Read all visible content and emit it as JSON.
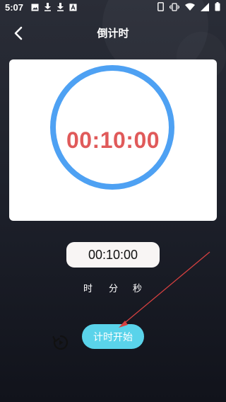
{
  "status_bar": {
    "time": "5:07",
    "left_icons": [
      "image-icon",
      "download-icon",
      "download-icon",
      "text-a-icon"
    ],
    "right_icons": [
      "phone-icon",
      "vibrate-icon",
      "wifi-icon",
      "signal-icon",
      "battery-icon"
    ]
  },
  "header": {
    "title": "倒计时",
    "back_icon": "chevron-left-icon"
  },
  "timer": {
    "display": "00:10:00",
    "ring_color": "#4ea1f3",
    "text_color": "#e05a5a"
  },
  "time_input": {
    "value": "00:10:00"
  },
  "units": {
    "hour": "时",
    "minute": "分",
    "second": "秒"
  },
  "controls": {
    "reset_icon": "reset-icon",
    "start_label": "计时开始",
    "start_color": "#5ad3ea"
  },
  "annotation": {
    "arrow_color": "#d64040"
  }
}
